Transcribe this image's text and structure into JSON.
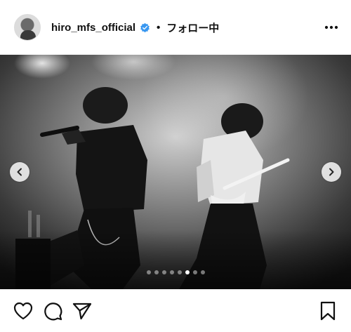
{
  "post": {
    "username": "hiro_mfs_official",
    "separator": "•",
    "follow_status": "フォロー中"
  },
  "carousel": {
    "total_slides": 8,
    "active_index": 5
  },
  "icons": {
    "avatar": "profile-avatar",
    "verified": "verified-badge-icon",
    "more": "more-options-icon",
    "prev": "chevron-left-icon",
    "next": "chevron-right-icon",
    "like": "heart-icon",
    "comment": "comment-icon",
    "share": "send-icon",
    "save": "bookmark-icon"
  },
  "colors": {
    "verified": "#3897f0",
    "text": "#111111"
  }
}
